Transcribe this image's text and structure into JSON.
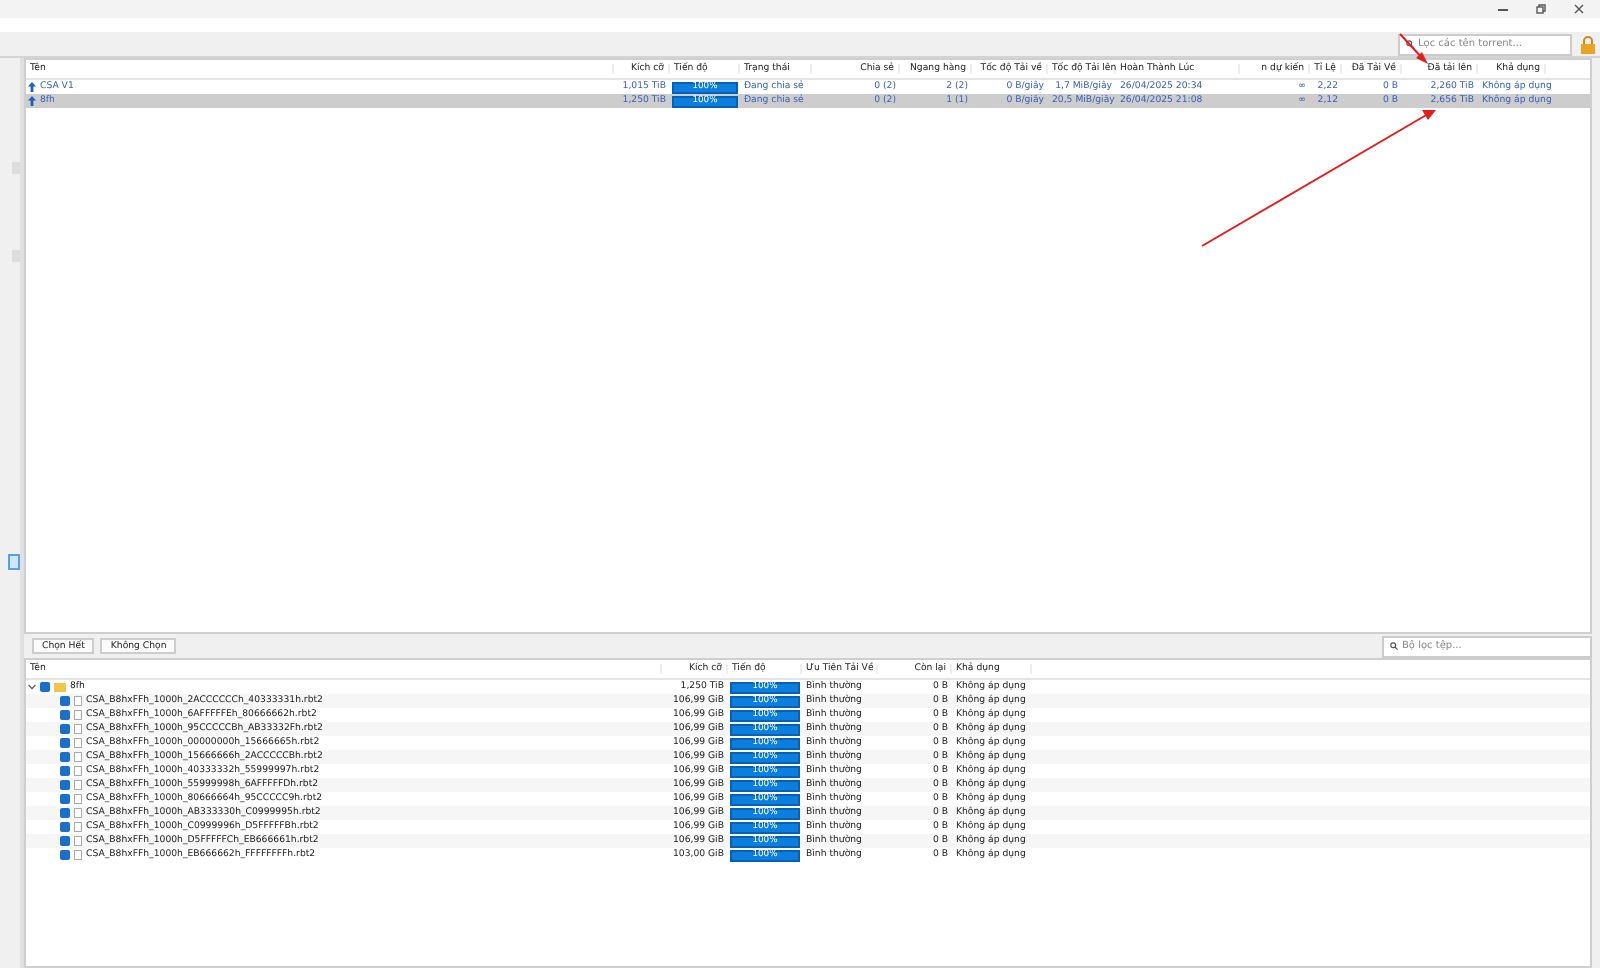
{
  "torrent_search": {
    "placeholder": "Lọc các tên torrent..."
  },
  "torrents": {
    "columns": [
      "Tên",
      "Kích cỡ",
      "Tiến độ",
      "Trạng thái",
      "Chia sẻ",
      "Ngang hàng",
      "Tốc độ Tải về",
      "Tốc độ Tải lên",
      "Hoàn Thành Lúc",
      "n dự kiến",
      "Tỉ Lệ",
      "Đã Tải Về",
      "Đã tải lên",
      "Khả dụng"
    ],
    "rows": [
      {
        "selected": false,
        "name": "CSA V1",
        "size": "1,015 TiB",
        "level": 1,
        "progress": "100%",
        "status": "Đang chia sẻ",
        "seeds": "0 (2)",
        "peers": "2 (2)",
        "down": "0 B/giây",
        "up": "1,7 MiB/giây",
        "completed": "26/04/2025 20:34",
        "eta": "∞",
        "ratio": "2,22",
        "downloaded": "0 B",
        "uploaded": "2,260 TiB",
        "availability": "Không áp dụng"
      },
      {
        "selected": true,
        "name": "8fh",
        "size": "1,250 TiB",
        "level": 1,
        "progress": "100%",
        "status": "Đang chia sẻ",
        "seeds": "0 (2)",
        "peers": "1 (1)",
        "down": "0 B/giây",
        "up": "20,5 MiB/giây",
        "completed": "26/04/2025 21:08",
        "eta": "∞",
        "ratio": "2,12",
        "downloaded": "0 B",
        "uploaded": "2,656 TiB",
        "availability": "Không áp dụng"
      }
    ]
  },
  "sidebar": {
    "tabs": [
      {
        "selected": false
      },
      {
        "selected": false
      },
      {
        "selected": true
      }
    ]
  },
  "file_buttons": [
    "Chọn Hết",
    "Không Chọn"
  ],
  "file_search": {
    "placeholder": "Bộ lọc tệp..."
  },
  "files": {
    "columns": [
      "Tên",
      "Kích cỡ",
      "Tiến độ",
      "Ưu Tiên Tải Về",
      "Còn lại",
      "Khả dụng"
    ],
    "folder": {
      "name": "8fh",
      "expanded": true,
      "checked": true,
      "size": "1,250 TiB",
      "level": 1,
      "progress": "100%",
      "priority": "Bình thường",
      "remaining": "0 B",
      "availability": "Không áp dụng",
      "children": [
        {
          "name": "CSA_B8hxFFh_1000h_2ACCCCCCh_40333331h.rbt2",
          "checked": true,
          "size": "106,99 GiB",
          "level": 1,
          "progress": "100%",
          "priority": "Bình thường",
          "remaining": "0 B",
          "availability": "Không áp dụng"
        },
        {
          "name": "CSA_B8hxFFh_1000h_6AFFFFFEh_80666662h.rbt2",
          "checked": true,
          "size": "106,99 GiB",
          "level": 1,
          "progress": "100%",
          "priority": "Bình thường",
          "remaining": "0 B",
          "availability": "Không áp dụng"
        },
        {
          "name": "CSA_B8hxFFh_1000h_95CCCCCBh_AB33332Fh.rbt2",
          "checked": true,
          "size": "106,99 GiB",
          "level": 1,
          "progress": "100%",
          "priority": "Bình thường",
          "remaining": "0 B",
          "availability": "Không áp dụng"
        },
        {
          "name": "CSA_B8hxFFh_1000h_00000000h_15666665h.rbt2",
          "checked": true,
          "size": "106,99 GiB",
          "level": 1,
          "progress": "100%",
          "priority": "Bình thường",
          "remaining": "0 B",
          "availability": "Không áp dụng"
        },
        {
          "name": "CSA_B8hxFFh_1000h_15666666h_2ACCCCCBh.rbt2",
          "checked": true,
          "size": "106,99 GiB",
          "level": 1,
          "progress": "100%",
          "priority": "Bình thường",
          "remaining": "0 B",
          "availability": "Không áp dụng"
        },
        {
          "name": "CSA_B8hxFFh_1000h_40333332h_55999997h.rbt2",
          "checked": true,
          "size": "106,99 GiB",
          "level": 1,
          "progress": "100%",
          "priority": "Bình thường",
          "remaining": "0 B",
          "availability": "Không áp dụng"
        },
        {
          "name": "CSA_B8hxFFh_1000h_55999998h_6AFFFFFDh.rbt2",
          "checked": true,
          "size": "106,99 GiB",
          "level": 1,
          "progress": "100%",
          "priority": "Bình thường",
          "remaining": "0 B",
          "availability": "Không áp dụng"
        },
        {
          "name": "CSA_B8hxFFh_1000h_80666664h_95CCCCC9h.rbt2",
          "checked": true,
          "size": "106,99 GiB",
          "level": 1,
          "progress": "100%",
          "priority": "Bình thường",
          "remaining": "0 B",
          "availability": "Không áp dụng"
        },
        {
          "name": "CSA_B8hxFFh_1000h_AB333330h_C0999995h.rbt2",
          "checked": true,
          "size": "106,99 GiB",
          "level": 1,
          "progress": "100%",
          "priority": "Bình thường",
          "remaining": "0 B",
          "availability": "Không áp dụng"
        },
        {
          "name": "CSA_B8hxFFh_1000h_C0999996h_D5FFFFFBh.rbt2",
          "checked": true,
          "size": "106,99 GiB",
          "level": 1,
          "progress": "100%",
          "priority": "Bình thường",
          "remaining": "0 B",
          "availability": "Không áp dụng"
        },
        {
          "name": "CSA_B8hxFFh_1000h_D5FFFFFCh_EB666661h.rbt2",
          "checked": true,
          "size": "106,99 GiB",
          "level": 1,
          "progress": "100%",
          "priority": "Bình thường",
          "remaining": "0 B",
          "availability": "Không áp dụng"
        },
        {
          "name": "CSA_B8hxFFh_1000h_EB666662h_FFFFFFFFh.rbt2",
          "checked": true,
          "size": "103,00 GiB",
          "level": 1,
          "progress": "100%",
          "priority": "Bình thường",
          "remaining": "0 B",
          "availability": "Không áp dụng"
        }
      ]
    }
  }
}
